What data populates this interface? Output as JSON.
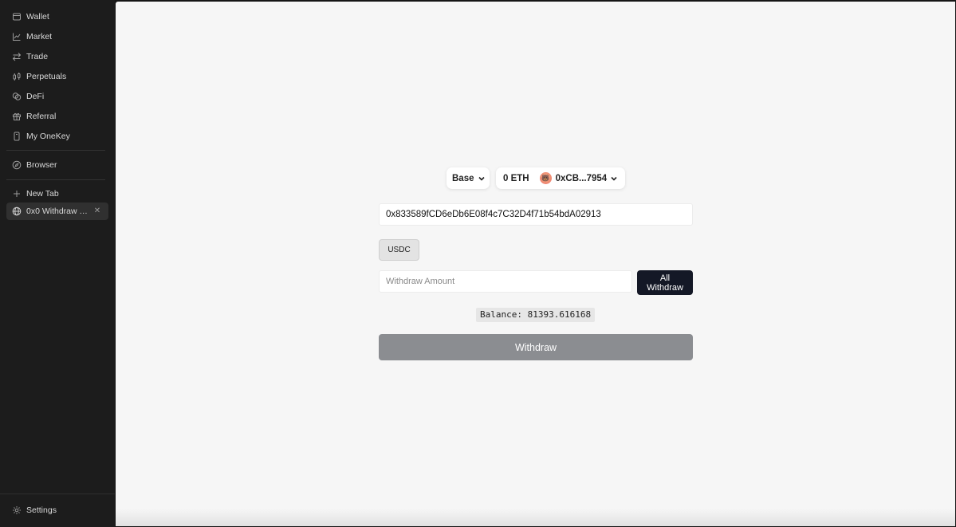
{
  "sidebar": {
    "items": [
      {
        "label": "Wallet",
        "icon": "wallet-icon"
      },
      {
        "label": "Market",
        "icon": "chart-icon"
      },
      {
        "label": "Trade",
        "icon": "swap-icon"
      },
      {
        "label": "Perpetuals",
        "icon": "candlestick-icon"
      },
      {
        "label": "DeFi",
        "icon": "coins-icon"
      },
      {
        "label": "Referral",
        "icon": "gift-icon"
      },
      {
        "label": "My OneKey",
        "icon": "device-icon"
      }
    ],
    "browser_label": "Browser",
    "new_tab_label": "New Tab",
    "open_tab_label": "0x0 Withdraw T...",
    "settings_label": "Settings"
  },
  "header": {
    "network": "Base",
    "eth_balance": "0 ETH",
    "account": "0xCB...7954"
  },
  "form": {
    "address_value": "0x833589fCD6eDb6E08f4c7C32D4f71b54bdA02913",
    "token_label": "USDC",
    "amount_placeholder": "Withdraw Amount",
    "all_withdraw_line1": "All",
    "all_withdraw_line2": "Withdraw",
    "balance_text": "Balance: 81393.616168",
    "withdraw_label": "Withdraw"
  }
}
